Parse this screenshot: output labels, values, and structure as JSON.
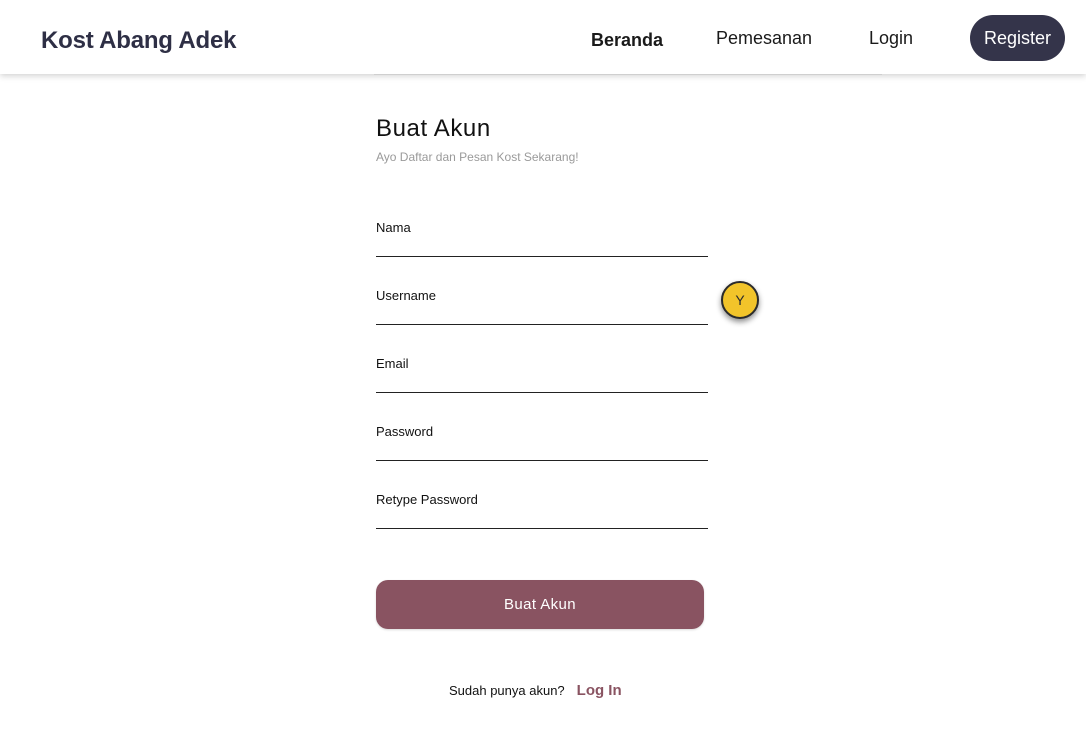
{
  "navbar": {
    "brand": "Kost Abang Adek",
    "links": [
      {
        "label": "Beranda"
      },
      {
        "label": "Pemesanan"
      },
      {
        "label": "Login"
      }
    ],
    "register_label": "Register"
  },
  "form": {
    "title": "Buat Akun",
    "subtitle": "Ayo Daftar dan Pesan Kost Sekarang!",
    "fields": [
      {
        "label": "Nama",
        "value": ""
      },
      {
        "label": "Username",
        "value": ""
      },
      {
        "label": "Email",
        "value": ""
      },
      {
        "label": "Password",
        "value": ""
      },
      {
        "label": "Retype Password",
        "value": ""
      }
    ],
    "submit_label": "Buat Akun",
    "login_prompt": "Sudah punya akun?",
    "login_link": "Log In"
  },
  "cursor_badge": {
    "letter": "Y",
    "color": "#f2c42a"
  },
  "colors": {
    "brand": "#2e2f45",
    "register_bg": "#34344a",
    "accent": "#895361"
  }
}
